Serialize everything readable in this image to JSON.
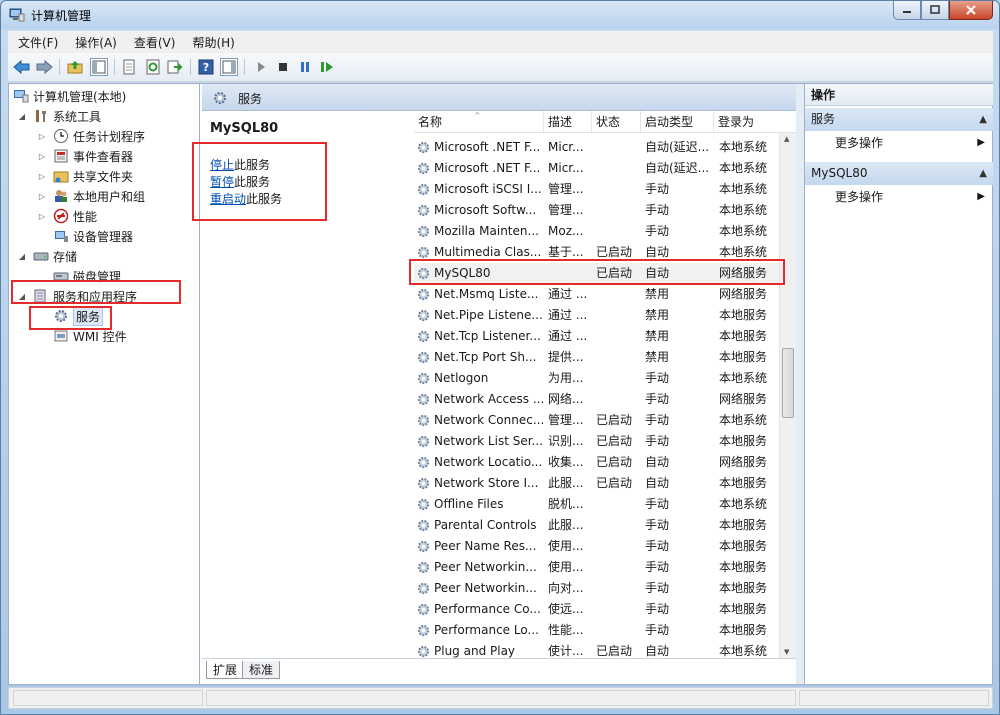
{
  "window": {
    "title": "计算机管理"
  },
  "menu": [
    "文件(F)",
    "操作(A)",
    "查看(V)",
    "帮助(H)"
  ],
  "tree": {
    "root": "计算机管理(本地)",
    "system_tools": "系统工具",
    "task_scheduler": "任务计划程序",
    "event_viewer": "事件查看器",
    "shared_folders": "共享文件夹",
    "local_users": "本地用户和组",
    "performance": "性能",
    "device_manager": "设备管理器",
    "storage": "存储",
    "disk_management": "磁盘管理",
    "services_apps": "服务和应用程序",
    "services": "服务",
    "wmi": "WMI 控件"
  },
  "middle": {
    "header_title": "服务",
    "selected_service": "MySQL80",
    "links": [
      {
        "link": "停止",
        "rest": "此服务"
      },
      {
        "link": "暂停",
        "rest": "此服务"
      },
      {
        "link": "重启动",
        "rest": "此服务"
      }
    ],
    "columns": [
      "名称",
      "描述",
      "状态",
      "启动类型",
      "登录为"
    ],
    "tabs": [
      "扩展",
      "标准"
    ]
  },
  "services": [
    {
      "name": "Microsoft .NET F...",
      "desc": "Micr...",
      "status": "",
      "startup": "自动(延迟...",
      "logon": "本地系统"
    },
    {
      "name": "Microsoft .NET F...",
      "desc": "Micr...",
      "status": "",
      "startup": "自动(延迟...",
      "logon": "本地系统"
    },
    {
      "name": "Microsoft iSCSI I...",
      "desc": "管理...",
      "status": "",
      "startup": "手动",
      "logon": "本地系统"
    },
    {
      "name": "Microsoft Softw...",
      "desc": "管理...",
      "status": "",
      "startup": "手动",
      "logon": "本地系统"
    },
    {
      "name": "Mozilla Mainten...",
      "desc": "Moz...",
      "status": "",
      "startup": "手动",
      "logon": "本地系统"
    },
    {
      "name": "Multimedia Clas...",
      "desc": "基于...",
      "status": "已启动",
      "startup": "自动",
      "logon": "本地系统"
    },
    {
      "name": "MySQL80",
      "desc": "",
      "status": "已启动",
      "startup": "自动",
      "logon": "网络服务"
    },
    {
      "name": "Net.Msmq Liste...",
      "desc": "通过 ...",
      "status": "",
      "startup": "禁用",
      "logon": "网络服务"
    },
    {
      "name": "Net.Pipe Listene...",
      "desc": "通过 ...",
      "status": "",
      "startup": "禁用",
      "logon": "本地服务"
    },
    {
      "name": "Net.Tcp Listener...",
      "desc": "通过 ...",
      "status": "",
      "startup": "禁用",
      "logon": "本地服务"
    },
    {
      "name": "Net.Tcp Port Sh...",
      "desc": "提供...",
      "status": "",
      "startup": "禁用",
      "logon": "本地服务"
    },
    {
      "name": "Netlogon",
      "desc": "为用...",
      "status": "",
      "startup": "手动",
      "logon": "本地系统"
    },
    {
      "name": "Network Access ...",
      "desc": "网络...",
      "status": "",
      "startup": "手动",
      "logon": "网络服务"
    },
    {
      "name": "Network Connec...",
      "desc": "管理...",
      "status": "已启动",
      "startup": "手动",
      "logon": "本地系统"
    },
    {
      "name": "Network List Ser...",
      "desc": "识别...",
      "status": "已启动",
      "startup": "手动",
      "logon": "本地服务"
    },
    {
      "name": "Network Locatio...",
      "desc": "收集...",
      "status": "已启动",
      "startup": "自动",
      "logon": "网络服务"
    },
    {
      "name": "Network Store I...",
      "desc": "此服...",
      "status": "已启动",
      "startup": "自动",
      "logon": "本地服务"
    },
    {
      "name": "Offline Files",
      "desc": "脱机...",
      "status": "",
      "startup": "手动",
      "logon": "本地系统"
    },
    {
      "name": "Parental Controls",
      "desc": "此服...",
      "status": "",
      "startup": "手动",
      "logon": "本地服务"
    },
    {
      "name": "Peer Name Res...",
      "desc": "使用...",
      "status": "",
      "startup": "手动",
      "logon": "本地服务"
    },
    {
      "name": "Peer Networkin...",
      "desc": "使用...",
      "status": "",
      "startup": "手动",
      "logon": "本地服务"
    },
    {
      "name": "Peer Networkin...",
      "desc": "向对...",
      "status": "",
      "startup": "手动",
      "logon": "本地服务"
    },
    {
      "name": "Performance Co...",
      "desc": "使远...",
      "status": "",
      "startup": "手动",
      "logon": "本地服务"
    },
    {
      "name": "Performance Lo...",
      "desc": "性能...",
      "status": "",
      "startup": "手动",
      "logon": "本地服务"
    },
    {
      "name": "Plug and Play",
      "desc": "使计...",
      "status": "已启动",
      "startup": "自动",
      "logon": "本地系统"
    }
  ],
  "actions": {
    "header": "操作",
    "section1": "服务",
    "section2": "MySQL80",
    "more": "更多操作"
  },
  "colors": {
    "accent_red": "#e32b2b",
    "link_blue": "#0050b0"
  }
}
